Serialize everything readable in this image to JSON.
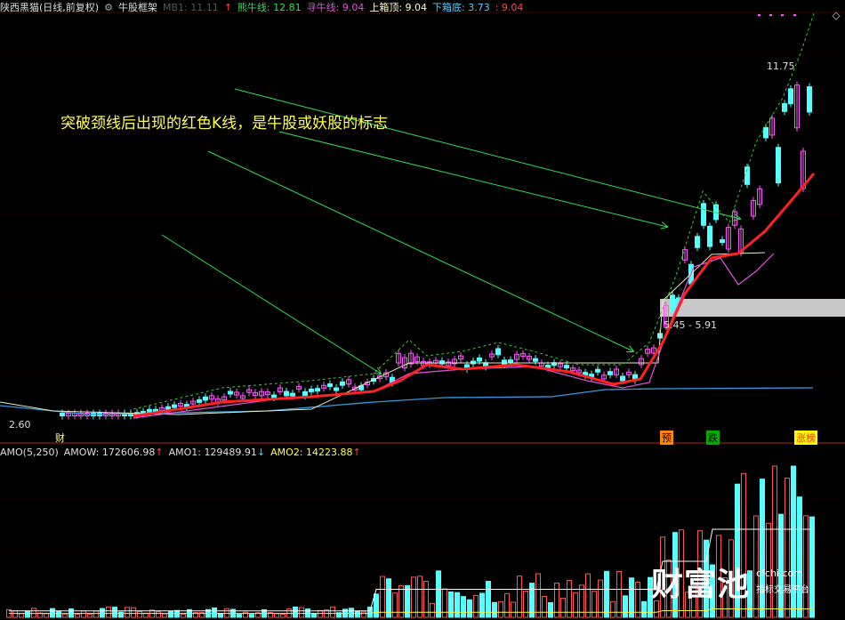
{
  "header": {
    "stock_name": "陕西黑猫(日线,前复权)",
    "indicator_name": "牛股框架",
    "mb1": "MB1: 11.11",
    "bull_line": "熊牛线: 12.81",
    "seek_bull": "寻牛线: 9.04",
    "upper_top": "上箱顶: 9.04",
    "lower_bottom": "下箱底: 3.73",
    "extra": ": 9.04",
    "arrow_up": "↑"
  },
  "annotation": "突破颈线后出现的红色K线，是牛股或妖股的标志",
  "price_labels": {
    "high": "11.75",
    "low": "2.60",
    "range": "5.45 - 5.91"
  },
  "markers": {
    "cai": "财",
    "yu": "预",
    "die": "跌",
    "zhangbang": "涨榜"
  },
  "amo_panel": {
    "title": "AMO(5,250)",
    "amow": "AMOW: 172606.98",
    "amo1": "AMO1: 129489.91",
    "amo2": "AMO2: 14223.88",
    "up": "↑",
    "down": "↓"
  },
  "watermark": {
    "big": "财富池",
    "site": "cfchi.com",
    "sub": "指标交易平台"
  },
  "colors": {
    "up_candle": "#ff55ff",
    "down_candle": "#55ffff",
    "red_line": "#ff2222",
    "blue_line": "#3399dd",
    "green_dashed": "#33cc33",
    "arrow": "#33dd55",
    "volume_up": "#ff5555",
    "volume_down": "#55ffff"
  }
}
